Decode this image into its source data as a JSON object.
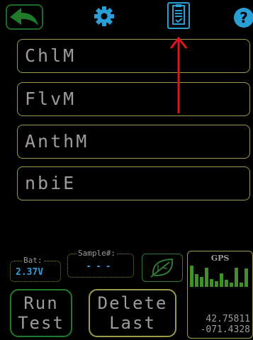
{
  "toolbar": {
    "back_icon": "back-arrow-icon",
    "settings_icon": "gear-icon",
    "clipboard_icon": "clipboard-check-icon",
    "help_icon": "question-mark-icon",
    "help_label": "?"
  },
  "fields": [
    {
      "label": "ChlM"
    },
    {
      "label": "FlvM"
    },
    {
      "label": "AnthM"
    },
    {
      "label": "nbiE"
    }
  ],
  "battery": {
    "legend": "Bat:",
    "value": "2.37V"
  },
  "sample": {
    "legend": "Sample#:",
    "value": "---"
  },
  "leaf_button": {
    "icon": "leaf-icon"
  },
  "gps": {
    "title": "GPS",
    "lat": "42.75811",
    "lon": "-071.4328",
    "signal_levels": [
      0.95,
      0.55,
      0.45,
      0.85,
      0.35,
      0.25,
      0.6,
      0.3,
      0.2,
      0.85,
      0.2,
      0.8
    ]
  },
  "actions": {
    "run_line1": "Run",
    "run_line2": "Test",
    "delete_line1": "Delete",
    "delete_line2": "Last"
  },
  "colors": {
    "accent_blue": "#2a9fd6",
    "green": "#1f7a2a",
    "olive": "#9a9a4a",
    "arrow_red": "#e0141a"
  }
}
